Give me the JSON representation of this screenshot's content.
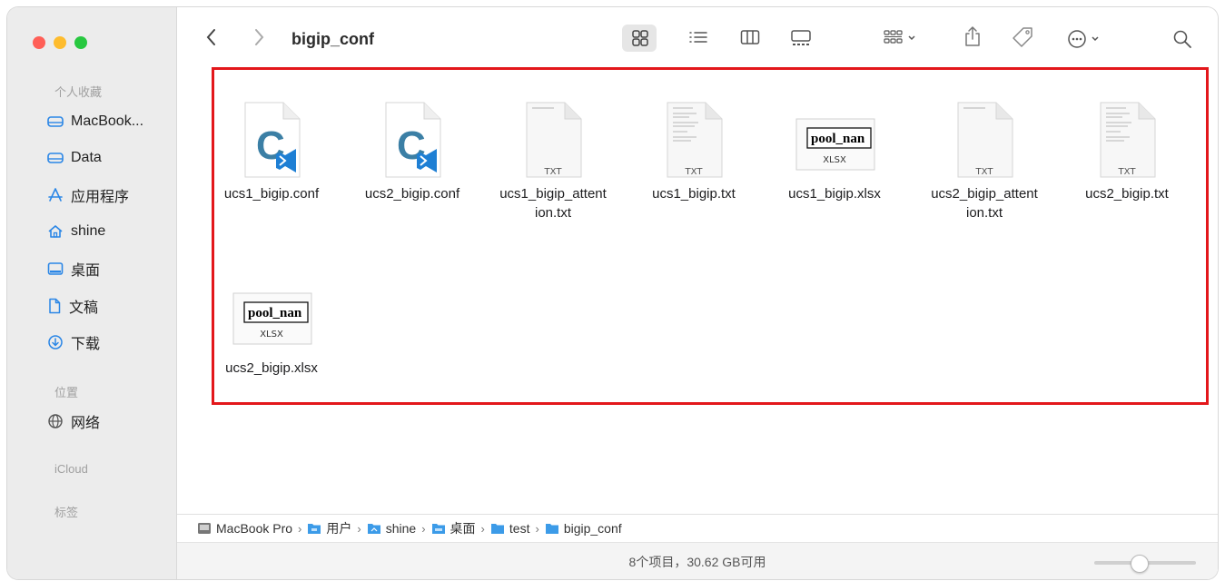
{
  "window": {
    "title": "bigip_conf"
  },
  "sidebar": {
    "favorites_title": "个人收藏",
    "favorites": [
      {
        "label": "MacBook...",
        "icon": "drive-icon"
      },
      {
        "label": "Data",
        "icon": "drive-icon"
      },
      {
        "label": "应用程序",
        "icon": "applications-icon"
      },
      {
        "label": "shine",
        "icon": "home-icon"
      },
      {
        "label": "桌面",
        "icon": "desktop-icon"
      },
      {
        "label": "文稿",
        "icon": "document-icon"
      },
      {
        "label": "下载",
        "icon": "download-icon"
      }
    ],
    "locations_title": "位置",
    "locations": [
      {
        "label": "网络",
        "icon": "network-icon"
      }
    ],
    "icloud_title": "iCloud",
    "tags_title": "标签"
  },
  "files": [
    {
      "name": "ucs1_bigip.conf",
      "type": "conf"
    },
    {
      "name": "ucs2_bigip.conf",
      "type": "conf"
    },
    {
      "name_l1": "ucs1_bigip_attent",
      "name_l2": "ion.txt",
      "type": "txt-blank",
      "badge": "TXT"
    },
    {
      "name": "ucs1_bigip.txt",
      "type": "txt",
      "badge": "TXT"
    },
    {
      "name": "ucs1_bigip.xlsx",
      "type": "xlsx",
      "preview": "pool_nan",
      "badge": "XLSX"
    },
    {
      "name_l1": "ucs2_bigip_attent",
      "name_l2": "ion.txt",
      "type": "txt-blank",
      "badge": "TXT"
    },
    {
      "name": "ucs2_bigip.txt",
      "type": "txt",
      "badge": "TXT"
    },
    {
      "name": "ucs2_bigip.xlsx",
      "type": "xlsx",
      "preview": "pool_nan",
      "badge": "XLSX"
    }
  ],
  "pathbar": [
    "MacBook Pro",
    "用户",
    "shine",
    "桌面",
    "test",
    "bigip_conf"
  ],
  "status": "8个项目，30.62 GB可用",
  "colors": {
    "highlight_border": "#e3171b",
    "folder": "#3c9be8",
    "vscode_blue": "#1e7fd4",
    "conf_c": "#3b7fa5"
  }
}
